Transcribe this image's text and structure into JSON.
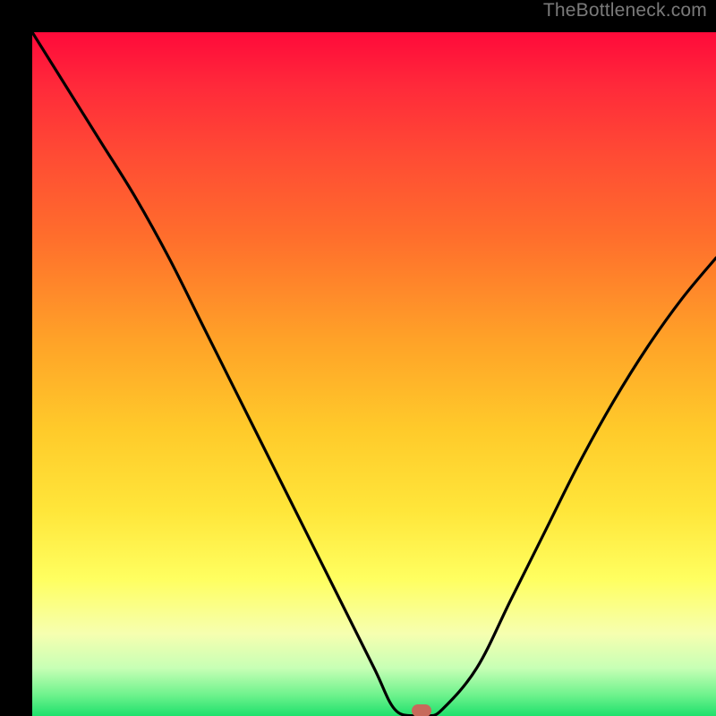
{
  "watermark": {
    "text": "TheBottleneck.com"
  },
  "chart_data": {
    "type": "line",
    "title": "",
    "xlabel": "",
    "ylabel": "",
    "xlim": [
      0,
      100
    ],
    "ylim": [
      0,
      100
    ],
    "grid": false,
    "legend": false,
    "series": [
      {
        "name": "bottleneck-curve",
        "x": [
          0,
          5,
          10,
          15,
          20,
          25,
          30,
          35,
          40,
          45,
          50,
          53,
          56,
          58,
          60,
          65,
          70,
          75,
          80,
          85,
          90,
          95,
          100
        ],
        "values": [
          100,
          92,
          84,
          76,
          67,
          57,
          47,
          37,
          27,
          17,
          7,
          1,
          0,
          0,
          1,
          7,
          17,
          27,
          37,
          46,
          54,
          61,
          67
        ]
      }
    ],
    "marker": {
      "x": 57,
      "y": 0,
      "shape": "rounded-rect",
      "color": "#c76a5b"
    },
    "background": {
      "type": "vertical-gradient",
      "stops": [
        {
          "pct": 0,
          "color": "#ff0a3a"
        },
        {
          "pct": 30,
          "color": "#ff6e2c"
        },
        {
          "pct": 58,
          "color": "#ffca2a"
        },
        {
          "pct": 80,
          "color": "#ffff60"
        },
        {
          "pct": 100,
          "color": "#1fe06c"
        }
      ]
    }
  }
}
